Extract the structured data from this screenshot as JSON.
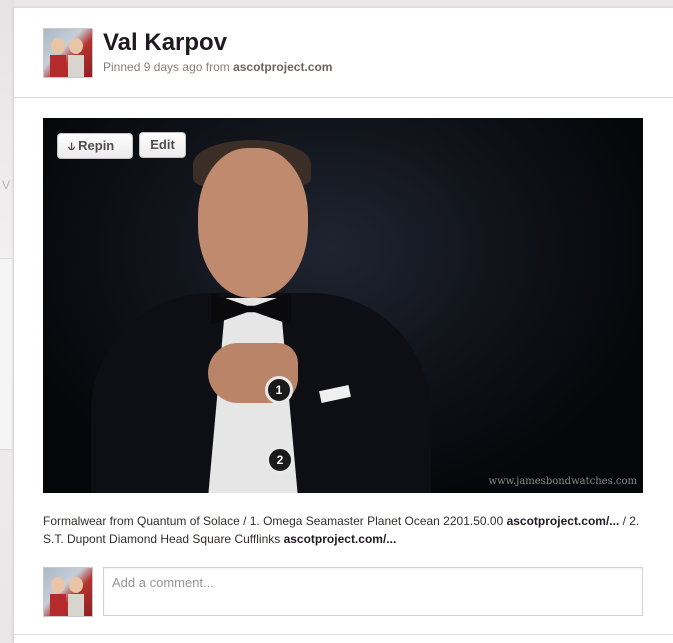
{
  "pin": {
    "user_name": "Val Karpov",
    "meta_prefix": "Pinned 9 days ago from ",
    "source_domain": "ascotproject.com",
    "repin_label": "Repin",
    "edit_label": "Edit",
    "marker_1": "1",
    "marker_2": "2",
    "watermark": "www.jamesbondwatches.com",
    "description": {
      "part1": "Formalwear from Quantum of Solace / 1. Omega Seamaster Planet Ocean 2201.50.00 ",
      "link1": "ascotproject.com/...",
      "part2": " / 2. S.T. Dupont Diamond Head Square Cufflinks ",
      "link2": "ascotproject.com/..."
    }
  },
  "comment": {
    "placeholder": "Add a comment..."
  },
  "background": {
    "ghost_text": "V"
  },
  "colors": {
    "page_bg": "#e9e7e7",
    "card_bg": "#ffffff",
    "name_text": "#211922",
    "meta_text": "#8c7e7e"
  }
}
